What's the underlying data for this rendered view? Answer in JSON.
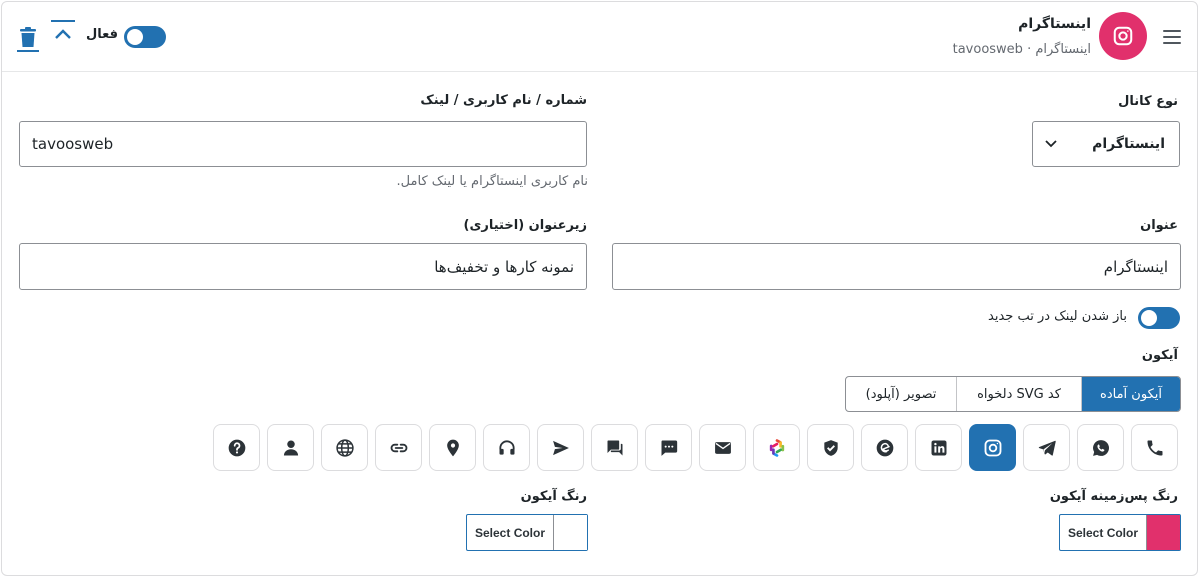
{
  "header": {
    "title": "اینستاگرام",
    "subtitle": "اینستاگرام · tavoosweb",
    "active_label": "فعال",
    "active": true
  },
  "form": {
    "channel_type": {
      "label": "نوع کانال",
      "value": "اینستاگرام"
    },
    "username": {
      "label": "شماره / نام کاربری / لینک",
      "value": "tavoosweb",
      "help": "نام کاربری اینستاگرام یا لینک کامل."
    },
    "title": {
      "label": "عنوان",
      "value": "اینستاگرام"
    },
    "subtitle": {
      "label": "زیرعنوان (اختیاری)",
      "value": "نمونه کارها و تخفیف‌ها"
    },
    "new_tab": {
      "label": "باز شدن لینک در تب جدید",
      "enabled": true
    }
  },
  "icon_section": {
    "label": "آیکون",
    "tabs": [
      {
        "label": "آیکون آماده",
        "active": true
      },
      {
        "label": "کد SVG دلخواه",
        "active": false
      },
      {
        "label": "تصویر (آپلود)",
        "active": false
      }
    ],
    "icons": [
      {
        "name": "phone-icon",
        "active": false
      },
      {
        "name": "whatsapp-icon",
        "active": false
      },
      {
        "name": "telegram-icon",
        "active": false
      },
      {
        "name": "instagram-icon",
        "active": true
      },
      {
        "name": "linkedin-icon",
        "active": false
      },
      {
        "name": "eitaa-icon",
        "active": false
      },
      {
        "name": "bale-icon",
        "active": false
      },
      {
        "name": "rubika-icon",
        "active": false
      },
      {
        "name": "email-icon",
        "active": false
      },
      {
        "name": "sms-icon",
        "active": false
      },
      {
        "name": "chat-icon",
        "active": false
      },
      {
        "name": "send-icon",
        "active": false
      },
      {
        "name": "headset-icon",
        "active": false
      },
      {
        "name": "location-icon",
        "active": false
      },
      {
        "name": "link-icon",
        "active": false
      },
      {
        "name": "globe-icon",
        "active": false
      },
      {
        "name": "user-icon",
        "active": false
      },
      {
        "name": "help-icon",
        "active": false
      }
    ]
  },
  "colors": {
    "bg_label": "رنگ پس‌زمینه آیکون",
    "bg_button": "Select Color",
    "bg_value": "#e1306c",
    "icon_label": "رنگ آیکون",
    "icon_button": "Select Color",
    "icon_value": "#ffffff",
    "accent": "#2271b1"
  }
}
